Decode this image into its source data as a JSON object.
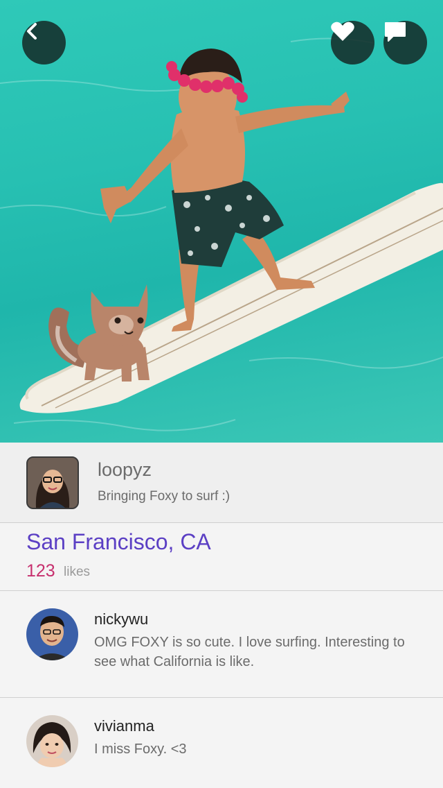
{
  "toolbar": {
    "back_icon": "chevron-left-icon",
    "like_icon": "heart-icon",
    "comment_icon": "speech-bubble-icon"
  },
  "post": {
    "username": "loopyz",
    "caption": "Bringing Foxy to surf :)",
    "location": "San Francisco, CA",
    "likes_count": "123",
    "likes_label": "likes"
  },
  "comments": [
    {
      "username": "nickywu",
      "text": "OMG FOXY is so cute. I love surfing. Interesting to see what California is like."
    },
    {
      "username": "vivianma",
      "text": "I miss Foxy. <3"
    }
  ],
  "colors": {
    "location": "#5b3fc4",
    "likes_count": "#c7306e",
    "water": "#27c0b2",
    "button_bg": "#142d2a"
  }
}
